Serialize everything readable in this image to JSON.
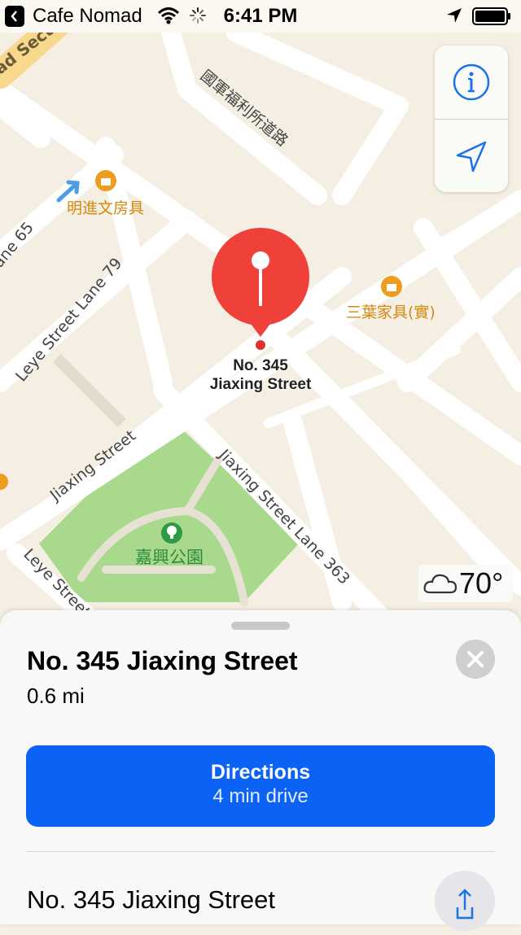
{
  "status_bar": {
    "carrier": "Cafe Nomad",
    "time": "6:41 PM"
  },
  "map": {
    "street_labels": [
      "ad Secti",
      "國軍福利所道路",
      "明進文房具",
      "ane 65",
      "Leye Street Lane 79",
      "三葉家具(實)",
      "Jiaxing Street",
      "Jiaxing Street Lane 363",
      "Leye Street"
    ],
    "park_label": "嘉興公園",
    "pin_label_line1": "No. 345",
    "pin_label_line2": "Jiaxing Street",
    "weather_temp": "70°",
    "colors": {
      "land": "#f5efe3",
      "road": "#ffffff",
      "park": "#a9d98c",
      "pin": "#f0403a",
      "poi": "#e99a1b"
    }
  },
  "controls": {
    "info_icon": "info-icon",
    "locate_icon": "location-arrow-icon"
  },
  "sheet": {
    "title": "No. 345 Jiaxing Street",
    "distance": "0.6 mi",
    "directions_label": "Directions",
    "directions_sub": "4 min drive",
    "address": "No. 345 Jiaxing Street",
    "accent": "#0b62f4"
  }
}
